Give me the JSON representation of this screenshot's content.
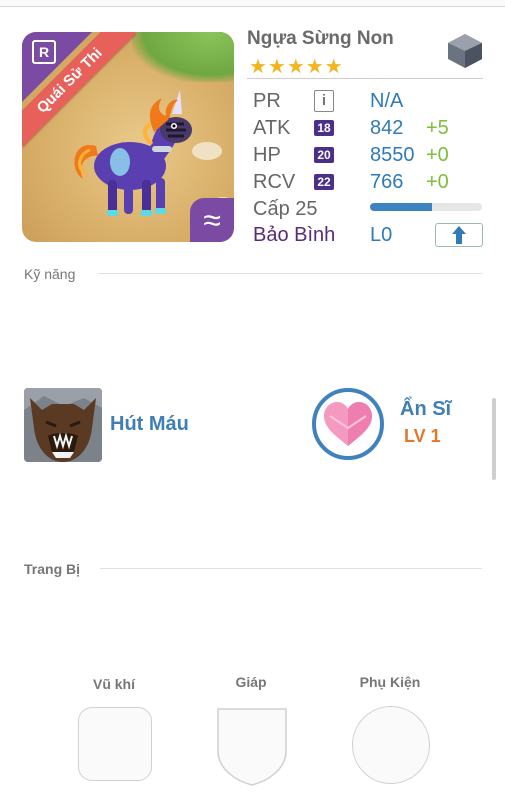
{
  "monster": {
    "name": "Ngựa Sừng Non",
    "stars": "★★★★★",
    "rarity": "R",
    "ribbon": "Quái Sử Thi",
    "element_symbol": "≈",
    "element_color": "#7b4aa3"
  },
  "stats": {
    "pr": {
      "label": "PR",
      "value": "N/A"
    },
    "atk": {
      "label": "ATK",
      "badge": "18",
      "value": "842",
      "bonus": "+5"
    },
    "hp": {
      "label": "HP",
      "badge": "20",
      "value": "8550",
      "bonus": "+0"
    },
    "rcv": {
      "label": "RCV",
      "badge": "22",
      "value": "766",
      "bonus": "+0"
    },
    "level": {
      "label": "Cấp 25",
      "progress_fraction": 0.55
    },
    "sign": {
      "label": "Bảo Bình",
      "value": "L0"
    }
  },
  "sections": {
    "skills": "Kỹ năng",
    "equipment": "Trang Bị"
  },
  "skill": {
    "name": "Hút Máu"
  },
  "awaken": {
    "title": "Ẩn Sĩ",
    "level": "LV 1"
  },
  "equipment": {
    "weapon": "Vũ khí",
    "armor": "Giáp",
    "accessory": "Phụ Kiện"
  },
  "colors": {
    "accent_blue": "#3f7fb5",
    "bonus_green": "#7cbf3a",
    "star_gold": "#f2b51f",
    "ribbon_red": "#e8605a",
    "awaken_orange": "#e0792e"
  }
}
